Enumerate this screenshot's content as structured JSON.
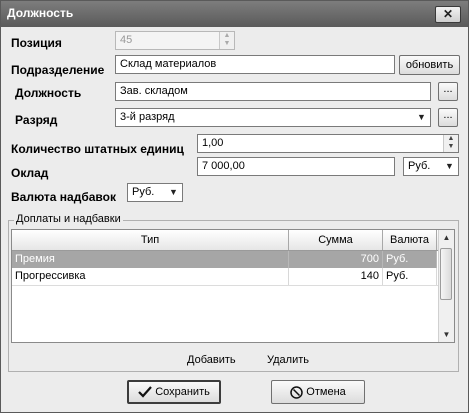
{
  "window": {
    "title": "Должность",
    "close_glyph": "✕"
  },
  "fields": {
    "position_label": "Позиция",
    "position_value": "45",
    "department_label": "Подразделение",
    "department_value": "Склад материалов",
    "refresh_button": "обновить",
    "job_label": "Должность",
    "job_value": "Зав. складом",
    "browse_button": "...",
    "grade_label": "Разряд",
    "grade_value": "3-й разряд",
    "staff_units_label": "Количество штатных единиц",
    "staff_units_value": "1,00",
    "salary_label": "Оклад",
    "salary_value": "7 000,00",
    "salary_currency": "Руб.",
    "bonus_currency_label": "Валюта надбавок",
    "bonus_currency_value": "Руб."
  },
  "allowances": {
    "group_title": "Доплаты и надбавки",
    "columns": [
      "Тип",
      "Сумма",
      "Валюта"
    ],
    "rows": [
      {
        "type": "Премия",
        "amount": "700",
        "currency": "Руб.",
        "selected": true
      },
      {
        "type": "Прогрессивка",
        "amount": "140",
        "currency": "Руб.",
        "selected": false
      }
    ],
    "add_label": "Добавить",
    "delete_label": "Удалить"
  },
  "footer": {
    "save_label": "Сохранить",
    "cancel_label": "Отмена"
  },
  "icons": {
    "save": "checkmark-icon",
    "cancel": "cancel-icon",
    "close": "close-icon"
  },
  "colors": {
    "titlebar": "#5a5a5a",
    "selected_row": "#a6a6a6"
  }
}
